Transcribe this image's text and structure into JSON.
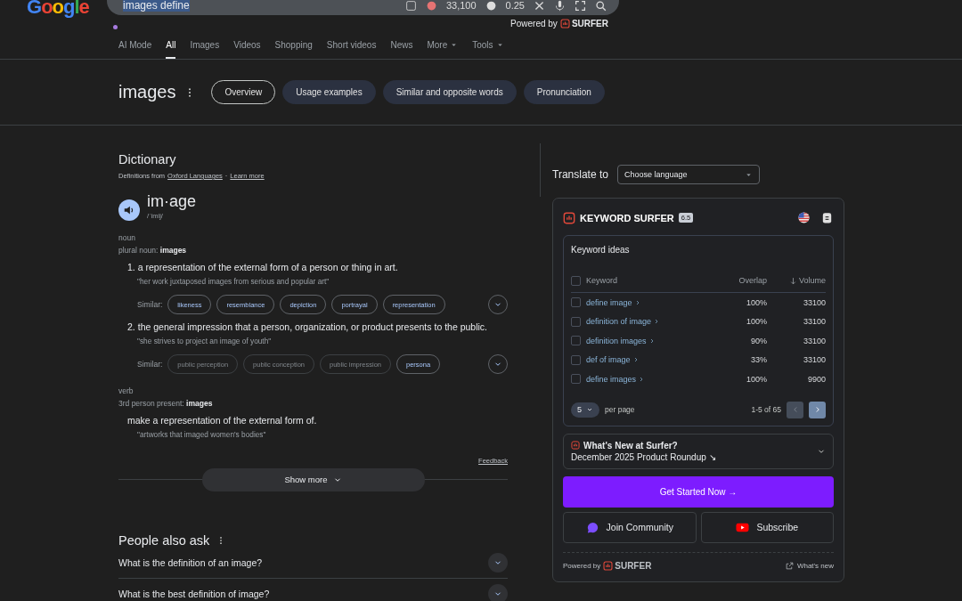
{
  "header": {
    "logo": "Google",
    "search": {
      "value": "images define",
      "stat_1": "33,100",
      "stat_2": "0.25"
    },
    "powered_by": {
      "label": "Powered by",
      "brand": "SURFER"
    }
  },
  "nav_tabs": [
    {
      "label": "AI Mode",
      "selected": false,
      "has_menu": false
    },
    {
      "label": "All",
      "selected": true,
      "has_menu": false
    },
    {
      "label": "Images",
      "selected": false,
      "has_menu": false
    },
    {
      "label": "Videos",
      "selected": false,
      "has_menu": false
    },
    {
      "label": "Shopping",
      "selected": false,
      "has_menu": false
    },
    {
      "label": "Short videos",
      "selected": false,
      "has_menu": false
    },
    {
      "label": "News",
      "selected": false,
      "has_menu": false
    },
    {
      "label": "More",
      "selected": false,
      "has_menu": true
    },
    {
      "label": "Tools",
      "selected": false,
      "has_menu": true
    }
  ],
  "term": {
    "title": "images",
    "chips": [
      {
        "label": "Overview",
        "selected": true
      },
      {
        "label": "Usage examples",
        "selected": false
      },
      {
        "label": "Similar and opposite words",
        "selected": false
      },
      {
        "label": "Pronunciation",
        "selected": false
      }
    ]
  },
  "dictionary": {
    "title": "Dictionary",
    "source_prefix": "Definitions from",
    "source_link": "Oxford Languages",
    "separator": "·",
    "learn_more": "Learn more",
    "headword": "im·age",
    "pronunciation": "/ˈimij/",
    "groups": [
      {
        "pos": "noun",
        "form_label": "plural noun:",
        "form": "images",
        "definitions": [
          {
            "number": "1.",
            "text": "a representation of the external form of a person or thing in art.",
            "example": "\"her work juxtaposed images from serious and popular art\"",
            "similar_label": "Similar:",
            "similar": [
              {
                "word": "likeness",
                "muted": false
              },
              {
                "word": "resemblance",
                "muted": false
              },
              {
                "word": "depiction",
                "muted": false
              },
              {
                "word": "portrayal",
                "muted": false
              },
              {
                "word": "representation",
                "muted": false
              }
            ]
          },
          {
            "number": "2.",
            "text": "the general impression that a person, organization, or product presents to the public.",
            "example": "\"she strives to project an image of youth\"",
            "similar_label": "Similar:",
            "similar": [
              {
                "word": "public perception",
                "muted": true
              },
              {
                "word": "public conception",
                "muted": true
              },
              {
                "word": "public impression",
                "muted": true
              },
              {
                "word": "persona",
                "muted": false
              }
            ]
          }
        ]
      },
      {
        "pos": "verb",
        "form_label": "3rd person present:",
        "form": "images",
        "definitions": [
          {
            "text": "make a representation of the external form of.",
            "example": "\"artworks that imaged women's bodies\""
          }
        ]
      }
    ],
    "feedback": "Feedback",
    "show_more": "Show more"
  },
  "people_also_ask": {
    "title": "People also ask",
    "questions": [
      {
        "text": "What is the definition of an image?"
      },
      {
        "text": "What is the best definition of image?"
      }
    ]
  },
  "translate": {
    "label": "Translate to",
    "placeholder": "Choose language"
  },
  "surfer": {
    "title": "KEYWORD SURFER",
    "version": "6.5",
    "keyword_ideas": {
      "title": "Keyword ideas",
      "columns": [
        {
          "label": "Keyword",
          "kind": "check"
        },
        {
          "label": "Overlap",
          "kind": "num"
        },
        {
          "label": "Volume",
          "kind": "sorted"
        }
      ],
      "all_checked": false,
      "rows": [
        {
          "keyword": "define image",
          "overlap": "100%",
          "volume": "33100",
          "checked": false
        },
        {
          "keyword": "definition of image",
          "overlap": "100%",
          "volume": "33100",
          "checked": false
        },
        {
          "keyword": "definition images",
          "overlap": "90%",
          "volume": "33100",
          "checked": false
        },
        {
          "keyword": "def of image",
          "overlap": "33%",
          "volume": "33100",
          "checked": false
        },
        {
          "keyword": "define images",
          "overlap": "100%",
          "volume": "9900",
          "checked": false
        }
      ],
      "per_page_value": "5",
      "per_page_label": "per page",
      "range": "1-5 of 65",
      "prev_disabled": true,
      "next_disabled": false
    },
    "news": {
      "title": "What's New at Surfer?",
      "subtitle": "December 2025 Product Roundup ↘",
      "expanded": false
    },
    "primary_button": "Get Started Now →",
    "community_button": "Join Community",
    "subscribe_button": "Subscribe",
    "footer": {
      "label": "Powered by",
      "brand": "SURFER",
      "link": "What's new"
    }
  }
}
